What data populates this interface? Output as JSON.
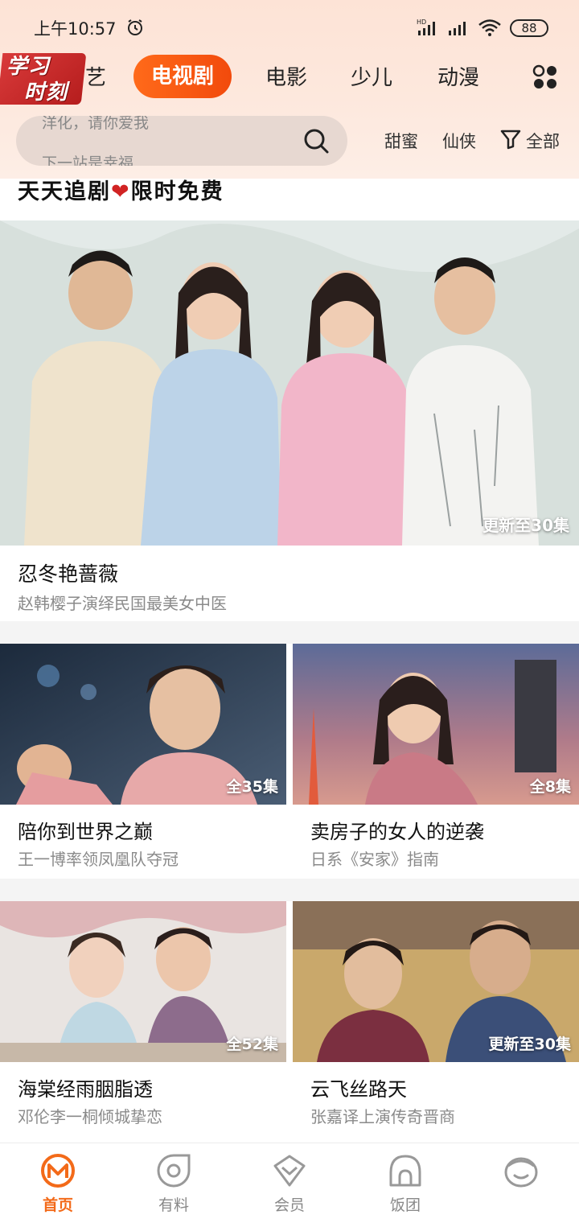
{
  "status": {
    "time": "上午10:57",
    "battery": "88",
    "network_label": "HD"
  },
  "logo": {
    "line1": "学习",
    "line2": "时刻"
  },
  "tabs": [
    {
      "label": "艺"
    },
    {
      "label": "电视剧",
      "active": true
    },
    {
      "label": "电影"
    },
    {
      "label": "少儿"
    },
    {
      "label": "动漫"
    }
  ],
  "search": {
    "placeholder_prev": "洋化，请你爱我",
    "placeholder_next": "下一站是幸福"
  },
  "filters": {
    "tag1": "甜蜜",
    "tag2": "仙侠",
    "all": "全部"
  },
  "promo": {
    "part1": "天天追剧",
    "heart": "❤",
    "part2": "限时免费"
  },
  "featured": {
    "badge": "更新至30集",
    "title": "忍冬艳蔷薇",
    "subtitle": "赵韩樱子演绎民国最美女中医"
  },
  "cards": [
    {
      "badge": "全35集",
      "title": "陪你到世界之巅",
      "subtitle": "王一博率领凤凰队夺冠"
    },
    {
      "badge": "全8集",
      "title": "卖房子的女人的逆袭",
      "subtitle": "日系《安家》指南"
    },
    {
      "badge": "全52集",
      "title": "海棠经雨胭脂透",
      "subtitle": "邓伦李一桐倾城挚恋"
    },
    {
      "badge": "更新至30集",
      "title": "云飞丝路天",
      "subtitle": "张嘉译上演传奇晋商"
    }
  ],
  "nav": [
    {
      "label": "首页",
      "icon": "home-m-icon",
      "active": true
    },
    {
      "label": "有料",
      "icon": "discover-icon"
    },
    {
      "label": "会员",
      "icon": "vip-icon"
    },
    {
      "label": "饭团",
      "icon": "fan-group-icon"
    },
    {
      "label": "",
      "icon": "profile-face-icon"
    }
  ],
  "colors": {
    "accent": "#f36a19",
    "header_bg": "#fde3d6",
    "logo_red": "#c92626"
  }
}
